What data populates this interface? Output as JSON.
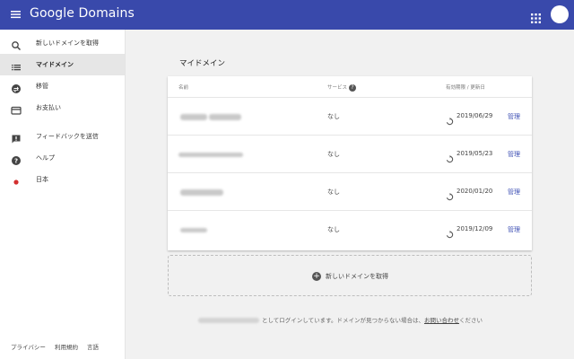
{
  "header": {
    "brand": "Google Domains"
  },
  "sidebar": {
    "items": [
      {
        "label": "新しいドメインを取得",
        "icon": "search-icon"
      },
      {
        "label": "マイドメイン",
        "icon": "list-icon",
        "active": true
      },
      {
        "label": "移管",
        "icon": "transfer-icon"
      },
      {
        "label": "お支払い",
        "icon": "credit-card-icon"
      },
      {
        "label": "フィードバックを送信",
        "icon": "feedback-icon"
      },
      {
        "label": "ヘルプ",
        "icon": "help-icon"
      },
      {
        "label": "日本",
        "icon": "japan-flag-icon"
      }
    ],
    "footer": [
      "プライバシー",
      "利用規約",
      "言語"
    ]
  },
  "main": {
    "title": "マイドメイン",
    "table": {
      "columns": [
        "名前",
        "サービス",
        "有効期限 / 更新日"
      ],
      "rows": [
        {
          "service": "なし",
          "date": "2019/06/29",
          "action": "管理"
        },
        {
          "service": "なし",
          "date": "2019/05/23",
          "action": "管理"
        },
        {
          "service": "なし",
          "date": "2020/01/20",
          "action": "管理"
        },
        {
          "service": "なし",
          "date": "2019/12/09",
          "action": "管理"
        }
      ]
    },
    "add_domain_label": "新しいドメインを取得",
    "login_text": "としてログインしています。ドメインが見つからない場合は、",
    "contact_link": "お問い合わせ",
    "login_suffix": "ください"
  },
  "colors": {
    "topbar": "#3949ab",
    "link": "#3f51b5",
    "flag_red": "#d32f2f"
  }
}
